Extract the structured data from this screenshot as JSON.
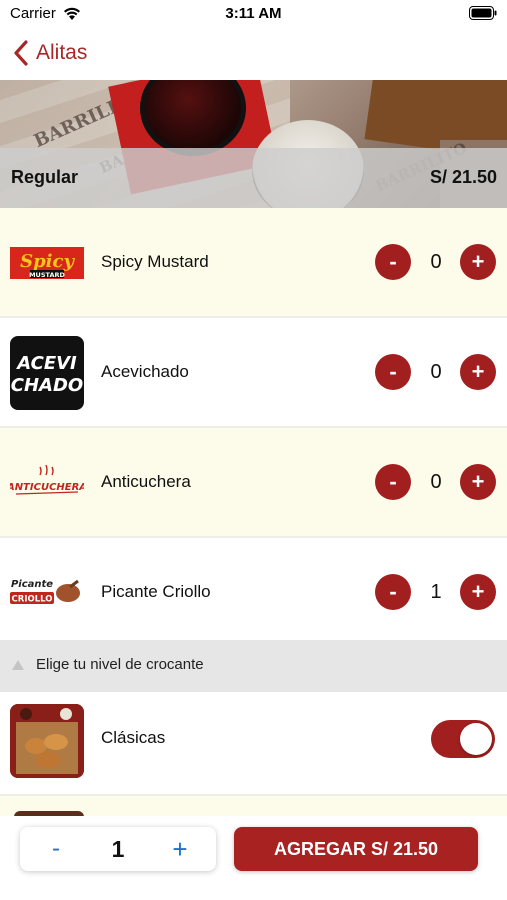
{
  "status_bar": {
    "carrier": "Carrier",
    "time": "3:11 AM",
    "icons": [
      "wifi-icon",
      "battery-icon"
    ]
  },
  "nav": {
    "back_label": "Alitas",
    "back_icon": "chevron-left-icon",
    "accent_color": "#a82828"
  },
  "hero": {
    "image": "wings-with-dipping-sauces-photo",
    "brand_text": "BARRILITO",
    "size_label": "Regular",
    "price": "S/ 21.50"
  },
  "sauces": [
    {
      "name": "Spicy Mustard",
      "logo_text": [
        "Spicy",
        "MUSTARD"
      ],
      "quantity": "0",
      "background": "#fdfbe9"
    },
    {
      "name": "Acevichado",
      "logo_text": [
        "ACEVI",
        "CHADO"
      ],
      "quantity": "0",
      "background": "#ffffff"
    },
    {
      "name": "Anticuchera",
      "logo_text": [
        "ANTICUCHERA"
      ],
      "quantity": "0",
      "background": "#fdfbe9"
    },
    {
      "name": "Picante Criollo",
      "logo_text": [
        "Picante",
        "CRIOLLO"
      ],
      "quantity": "1",
      "background": "#ffffff"
    }
  ],
  "stepper": {
    "minus_label": "-",
    "plus_label": "+",
    "button_color": "#a21f1f"
  },
  "crunch_section": {
    "title": "Elige tu nivel de crocante",
    "icon": "triangle-up-icon",
    "options": [
      {
        "name": "Clásicas",
        "selected": true
      }
    ]
  },
  "footer": {
    "minus_label": "-",
    "quantity": "1",
    "plus_label": "+",
    "add_button_label": "AGREGAR S/ 21.50",
    "stepper_color": "#1f6fd1",
    "button_color": "#a82222"
  }
}
